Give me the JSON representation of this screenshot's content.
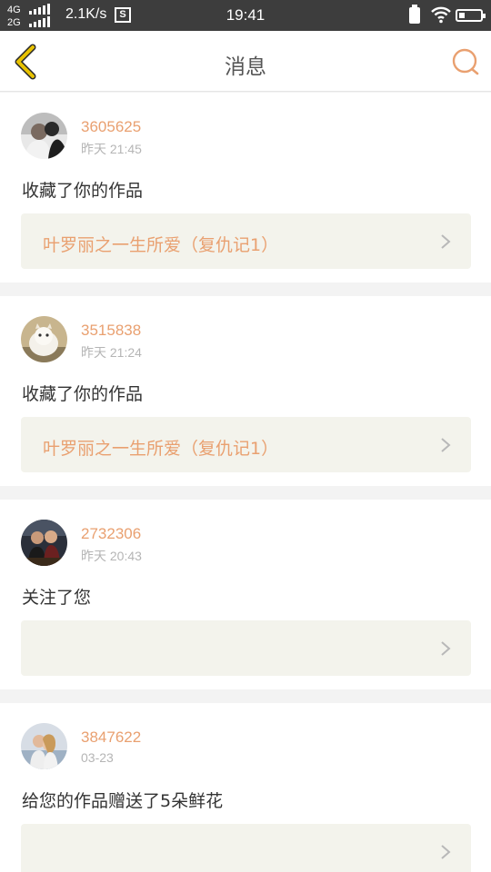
{
  "status_bar": {
    "net_top": "4G",
    "net_bottom": "2G",
    "speed": "2.1K/s",
    "s_badge": "S",
    "time": "19:41",
    "icons": [
      "signal-icon",
      "sim-icon",
      "charging-icon",
      "wifi-icon",
      "battery-icon"
    ]
  },
  "header": {
    "title": "消息",
    "back_icon": "chevron-left-icon",
    "search_icon": "search-icon"
  },
  "colors": {
    "accent": "#e9a070",
    "back_arrow": "#e8c200",
    "status_bar_bg": "#3d3d3d",
    "work_box_bg": "#f3f3ec"
  },
  "messages": [
    {
      "user_id": "3605625",
      "time": "昨天 21:45",
      "action": "收藏了你的作品",
      "work_title": "叶罗丽之一生所爱（复仇记1）"
    },
    {
      "user_id": "3515838",
      "time": "昨天 21:24",
      "action": "收藏了你的作品",
      "work_title": "叶罗丽之一生所爱（复仇记1）"
    },
    {
      "user_id": "2732306",
      "time": "昨天 20:43",
      "action": "关注了您",
      "work_title": ""
    },
    {
      "user_id": "3847622",
      "time": "03-23",
      "action": "给您的作品赠送了5朵鲜花",
      "work_title": ""
    }
  ]
}
